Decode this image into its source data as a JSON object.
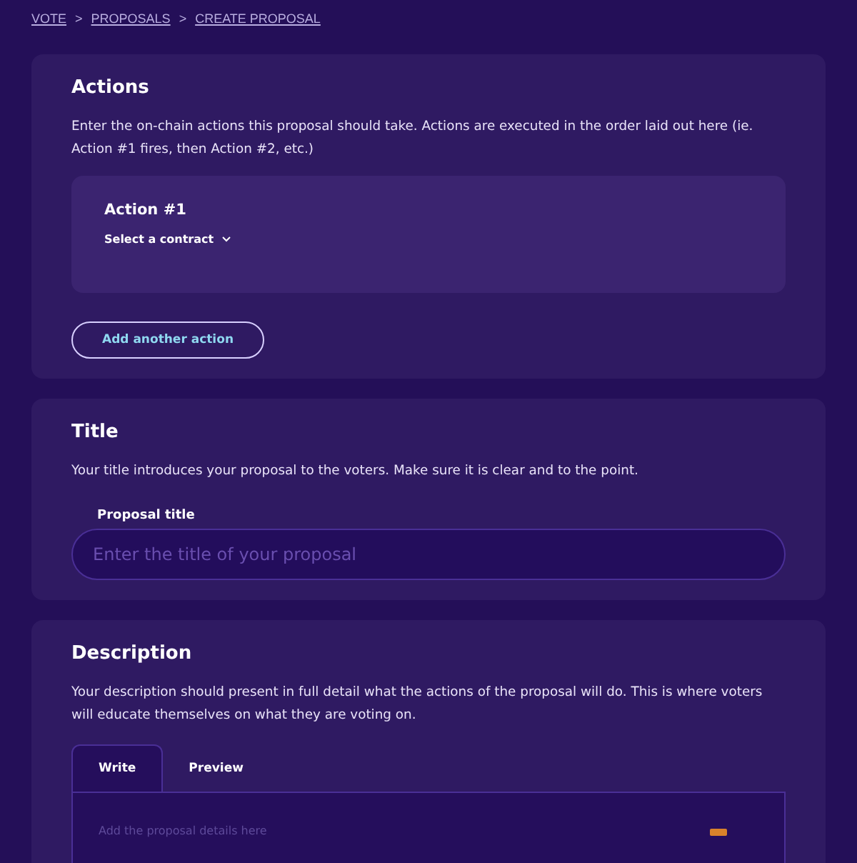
{
  "breadcrumb": [
    {
      "label": "VOTE"
    },
    {
      "label": ">"
    },
    {
      "label": "PROPOSALS"
    },
    {
      "label": ">"
    },
    {
      "label": "CREATE PROPOSAL"
    }
  ],
  "actions": {
    "heading": "Actions",
    "text": "Enter the on-chain actions this proposal should take. Actions are executed in the order laid out here (ie. Action #1 fires, then Action #2, etc.)",
    "items": [
      {
        "title": "Action #1",
        "select": "Select a contract"
      }
    ],
    "add_button": "Add another action"
  },
  "title_section": {
    "heading": "Title",
    "text": "Your title introduces your proposal to the voters. Make sure it is clear and to the point.",
    "field_label": "Proposal title",
    "placeholder": "Enter the title of your proposal"
  },
  "description": {
    "heading": "Description",
    "text": "Your description should present in full detail what the actions of the proposal will do. This is where voters will educate themselves on what they are voting on.",
    "tabs": [
      {
        "label": "Write",
        "selected": true
      },
      {
        "label": "Preview",
        "selected": false
      }
    ],
    "placeholder": "Add the proposal details here"
  }
}
